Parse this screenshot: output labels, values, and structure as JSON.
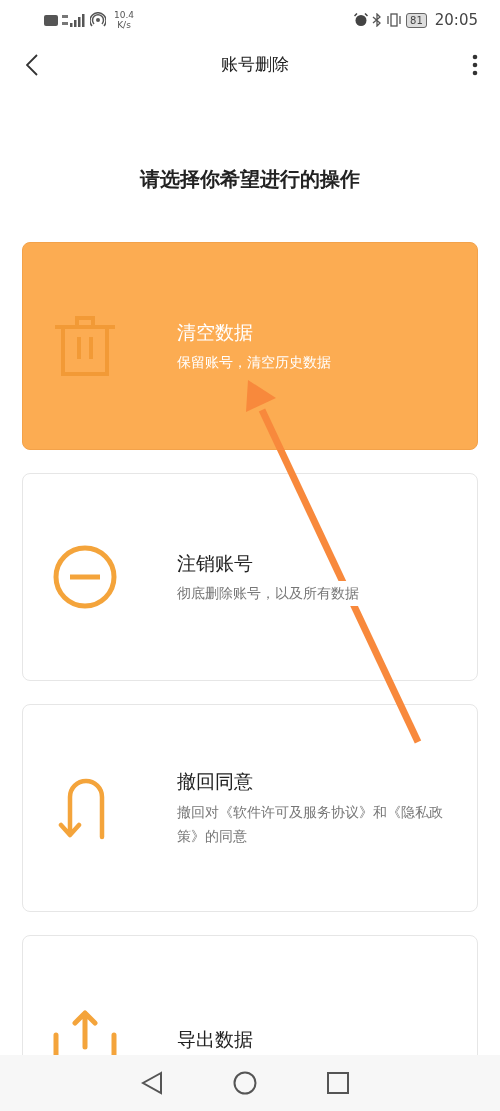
{
  "status_bar": {
    "net_speed": "10.4",
    "net_speed_unit": "K/s",
    "battery": "81",
    "time": "20:05"
  },
  "header": {
    "title": "账号删除"
  },
  "heading": "请选择你希望进行的操作",
  "options": [
    {
      "kind": "trash",
      "title": "清空数据",
      "subtitle": "保留账号，清空历史数据",
      "selected": true
    },
    {
      "kind": "minus",
      "title": "注销账号",
      "subtitle": "彻底删除账号，以及所有数据",
      "selected": false
    },
    {
      "kind": "undo",
      "title": "撤回同意",
      "subtitle": "撤回对《软件许可及服务协议》和《隐私政策》的同意",
      "selected": false
    },
    {
      "kind": "export",
      "title": "导出数据",
      "selected": false
    }
  ],
  "annotation_arrow": true
}
